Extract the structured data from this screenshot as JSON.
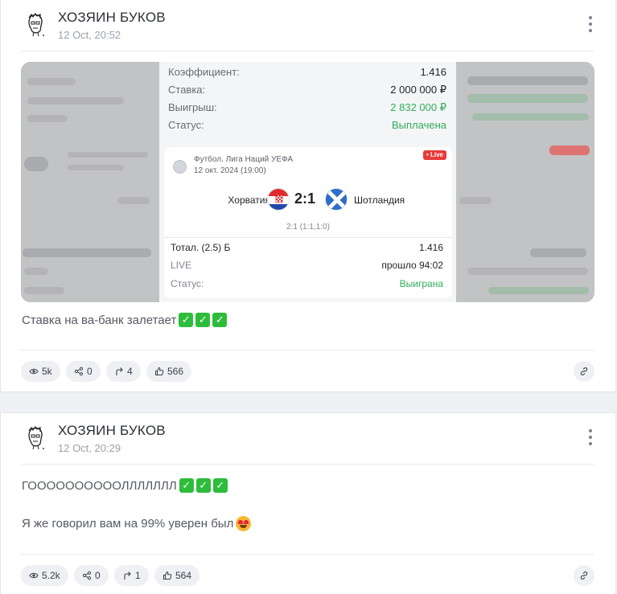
{
  "posts": [
    {
      "author": "ХОЗЯИН БУКОВ",
      "date": "12 Oct, 20:52",
      "receipt": {
        "coef_label": "Коэффициент:",
        "coef_value": "1.416",
        "stake_label": "Ставка:",
        "stake_value": "2 000 000 ₽",
        "win_label": "Выигрыш:",
        "win_value": "2 832 000 ₽",
        "status_label": "Статус:",
        "status_value": "Выплачена",
        "live_badge": "• Live",
        "league": "Футбол. Лига Наций УЕФА",
        "match_date": "12 окт. 2024 (19:00)",
        "team_home": "Хорватия",
        "score": "2:1",
        "team_away": "Шотландия",
        "period_score": "2:1 (1:1,1:0)",
        "bet_label": "Тотал. (2.5) Б",
        "bet_coef": "1.416",
        "live_label": "LIVE",
        "elapsed": "прошло 94:02",
        "card_status_label": "Статус:",
        "card_status_value": "Выиграна"
      },
      "text_lines": [
        "Ставка на ва-банк залетает"
      ],
      "stats": {
        "views": "5k",
        "shares": "0",
        "reposts": "4",
        "likes": "566"
      }
    },
    {
      "author": "ХОЗЯИН БУКОВ",
      "date": "12 Oct, 20:29",
      "text_lines": [
        "ГООООООООООЛЛЛЛЛЛЛ",
        "Я же говорил вам на 99% уверен был"
      ],
      "stats": {
        "views": "5.2k",
        "shares": "0",
        "reposts": "1",
        "likes": "564"
      }
    }
  ],
  "colors": {
    "green": "#2fae5a",
    "live_red": "#e83a3a",
    "check_green": "#2dbd3a"
  },
  "icons": [
    "avatar-sketch",
    "more-vertical-icon",
    "eye-icon",
    "share-icon",
    "repost-icon",
    "thumbs-up-icon",
    "link-icon",
    "check-emoji-icon",
    "heart-eyes-emoji-icon",
    "soccer-ball-icon",
    "croatia-flag-icon",
    "scotland-flag-icon"
  ]
}
